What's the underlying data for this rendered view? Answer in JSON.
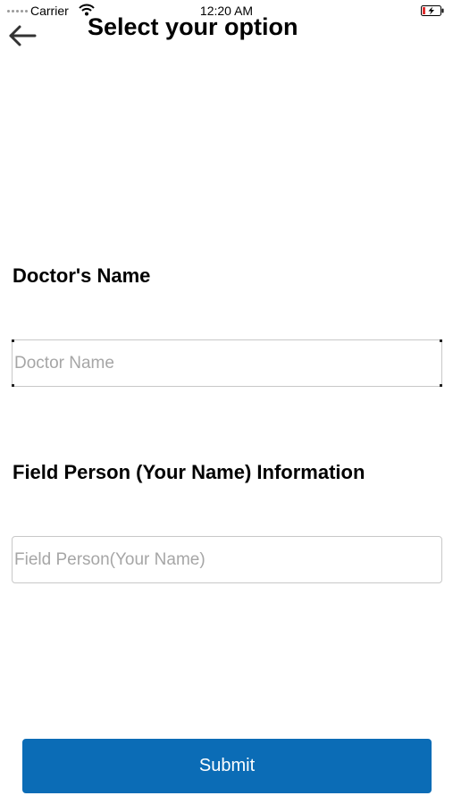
{
  "status_bar": {
    "carrier": "Carrier",
    "time": "12:20 AM",
    "icons": [
      "signal-dots-icon",
      "wifi-icon",
      "battery-charging-icon"
    ]
  },
  "header": {
    "back_icon": "arrow-left-icon",
    "title": "Select your option"
  },
  "form": {
    "doctor": {
      "label": "Doctor's Name",
      "placeholder": "Doctor Name",
      "value": ""
    },
    "field_person": {
      "label": "Field Person (Your Name) Information",
      "placeholder": "Field Person(Your Name)",
      "value": ""
    },
    "submit_label": "Submit"
  },
  "colors": {
    "accent": "#0b6cb6",
    "battery_low": "#e03030"
  }
}
